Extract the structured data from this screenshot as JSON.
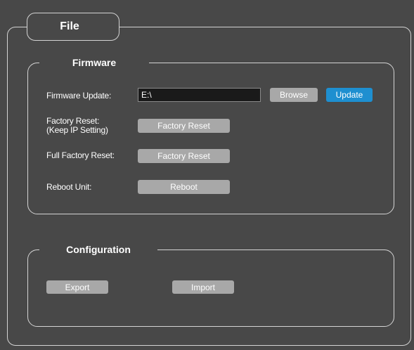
{
  "file_tab": {
    "title": "File"
  },
  "firmware": {
    "legend": "Firmware",
    "update_label": "Firmware Update:",
    "path_value": "E:\\",
    "browse_label": "Browse",
    "update_button": "Update",
    "factory_reset_label_line1": "Factory Reset:",
    "factory_reset_label_line2": "(Keep IP Setting)",
    "factory_reset_button": "Factory Reset",
    "full_factory_reset_label": "Full Factory Reset:",
    "full_factory_reset_button": "Factory Reset",
    "reboot_label": "Reboot Unit:",
    "reboot_button": "Reboot"
  },
  "configuration": {
    "legend": "Configuration",
    "export_button": "Export",
    "import_button": "Import"
  },
  "colors": {
    "background": "#484848",
    "border": "#d4d4d4",
    "button_gray": "#a8a8a8",
    "button_blue": "#1e8fd0",
    "input_bg": "#1a1a1a"
  }
}
